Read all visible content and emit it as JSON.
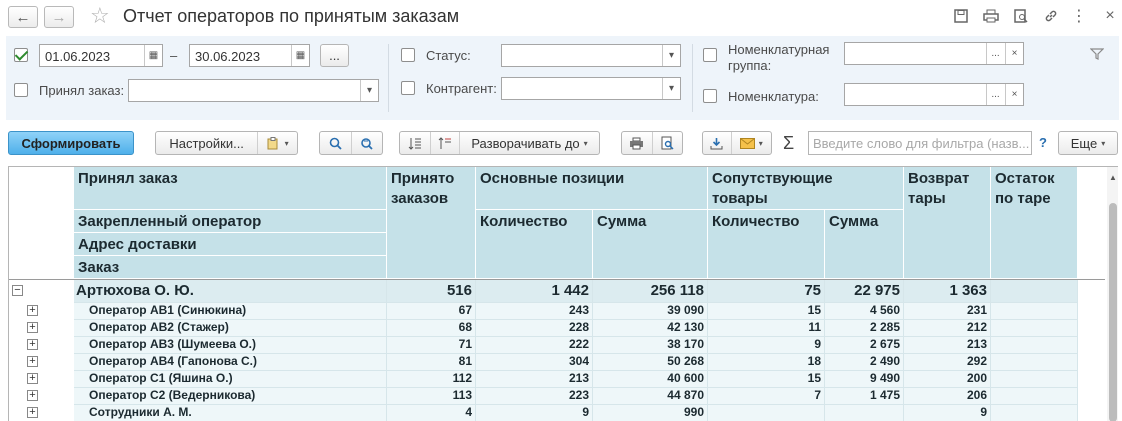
{
  "window": {
    "title": "Отчет операторов по принятым заказам",
    "back_icon": "←",
    "forward_icon": "→",
    "star_icon": "☆"
  },
  "filters": {
    "period_enabled": true,
    "date_from": "01.06.2023",
    "date_to": "30.06.2023",
    "date_sep": "–",
    "period_button": "...",
    "accepted_label": "Принял заказ:",
    "accepted_value": "",
    "status_label": "Статус:",
    "status_value": "",
    "counterparty_label": "Контрагент:",
    "counterparty_value": "",
    "nom_group_label_1": "Номенклатурная",
    "nom_group_label_2": "группа:",
    "nom_group_value": "",
    "nomenclature_label": "Номенклатура:",
    "nomenclature_value": "",
    "choose_button": "...",
    "clear_button": "×"
  },
  "toolbar": {
    "generate": "Сформировать",
    "settings": "Настройки...",
    "expand_to": "Разворачивать до",
    "sigma": "Σ",
    "search_placeholder": "Введите слово для фильтра (назв...",
    "help": "?",
    "more": "Еще"
  },
  "report": {
    "headers": {
      "accepted": "Принял заказ",
      "operator": "Закрепленный оператор",
      "address": "Адрес доставки",
      "order": "Заказ",
      "accepted_count_1": "Принято",
      "accepted_count_2": "заказов",
      "main_positions": "Основные позиции",
      "quantity": "Количество",
      "sum": "Сумма",
      "related_1": "Сопутствующие",
      "related_2": "товары",
      "related_quantity": "Количество",
      "related_sum": "Сумма",
      "return_1": "Возврат",
      "return_2": "тары",
      "rest_1": "Остаток",
      "rest_2": "по таре"
    },
    "group": {
      "name": "Артюхова О. Ю.",
      "accepted": "516",
      "qty": "1 442",
      "sum": "256 118",
      "rel_qty": "75",
      "rel_sum": "22 975",
      "ret": "1 363",
      "rest": ""
    },
    "rows": [
      {
        "name": "Оператор АВ1 (Синюкина)",
        "accepted": "67",
        "qty": "243",
        "sum": "39 090",
        "rel_qty": "15",
        "rel_sum": "4 560",
        "ret": "231",
        "rest": ""
      },
      {
        "name": "Оператор АВ2 (Стажер)",
        "accepted": "68",
        "qty": "228",
        "sum": "42 130",
        "rel_qty": "11",
        "rel_sum": "2 285",
        "ret": "212",
        "rest": ""
      },
      {
        "name": "Оператор АВ3 (Шумеева О.)",
        "accepted": "71",
        "qty": "222",
        "sum": "38 170",
        "rel_qty": "9",
        "rel_sum": "2 675",
        "ret": "213",
        "rest": ""
      },
      {
        "name": "Оператор АВ4 (Гапонова С.)",
        "accepted": "81",
        "qty": "304",
        "sum": "50 268",
        "rel_qty": "18",
        "rel_sum": "2 490",
        "ret": "292",
        "rest": ""
      },
      {
        "name": "Оператор С1 (Яшина О.)",
        "accepted": "112",
        "qty": "213",
        "sum": "40 600",
        "rel_qty": "15",
        "rel_sum": "9 490",
        "ret": "200",
        "rest": ""
      },
      {
        "name": "Оператор С2 (Ведерникова)",
        "accepted": "113",
        "qty": "223",
        "sum": "44 870",
        "rel_qty": "7",
        "rel_sum": "1 475",
        "ret": "206",
        "rest": ""
      },
      {
        "name": "Сотрудники А. М.",
        "accepted": "4",
        "qty": "9",
        "sum": "990",
        "rel_qty": "",
        "rel_sum": "",
        "ret": "9",
        "rest": ""
      }
    ]
  }
}
